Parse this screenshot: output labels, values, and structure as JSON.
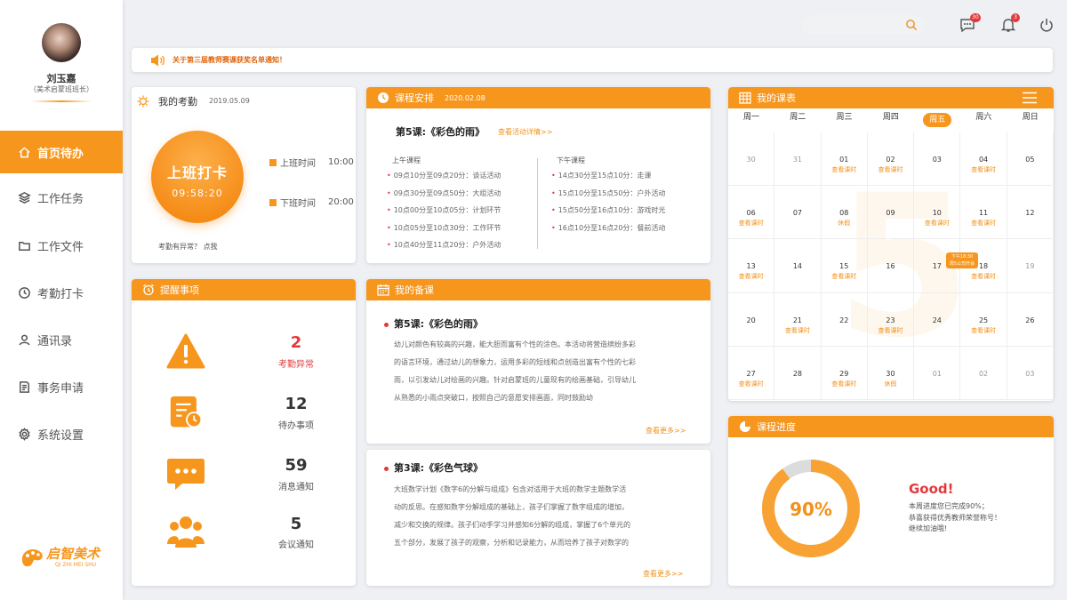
{
  "user": {
    "name": "刘玉嘉",
    "role": "（美术启蒙班班长）"
  },
  "nav": [
    {
      "label": "首页待办",
      "icon": "home-icon",
      "active": true
    },
    {
      "label": "工作任务",
      "icon": "layers-icon"
    },
    {
      "label": "工作文件",
      "icon": "folder-icon"
    },
    {
      "label": "考勤打卡",
      "icon": "clock-icon"
    },
    {
      "label": "通讯录",
      "icon": "person-icon"
    },
    {
      "label": "事务申请",
      "icon": "document-icon"
    },
    {
      "label": "系统设置",
      "icon": "gear-icon"
    }
  ],
  "brand": {
    "name": "启智美术",
    "sub": "QI ZHI MEI SHU"
  },
  "header": {
    "messages_badge": "30",
    "bell_badge": "3"
  },
  "notice": {
    "text": "关于第三届教师赛课获奖名单通知！"
  },
  "attendance": {
    "title": "我的考勤",
    "date": "2019.05.09",
    "punch_label": "上班打卡",
    "punch_time": "09:58:20",
    "start_label": "上班时间",
    "start_time": "10:00",
    "end_label": "下班时间",
    "end_time": "20:00",
    "exception": "考勤有异常？ 点我"
  },
  "schedule": {
    "title": "课程安排",
    "date": "2020.02.08",
    "lesson": "第5课:《彩色的雨》",
    "detail_link": "查看活动详情>>",
    "morning_title": "上午课程",
    "morning": [
      "09点10分至09点20分：谈话活动",
      "09点30分至09点50分：大组活动",
      "10点00分至10点05分：计划环节",
      "10点05分至10点30分：工作环节",
      "10点40分至11点20分：户外活动"
    ],
    "afternoon_title": "下午课程",
    "afternoon": [
      "14点30分至15点10分：走课",
      "15点10分至15点50分：户外活动",
      "15点50分至16点10分：游戏时光",
      "16点10分至16点20分：餐前活动"
    ]
  },
  "reminders": {
    "title": "提醒事项",
    "items": [
      {
        "num": "2",
        "label": "考勤异常",
        "icon": "warning-icon",
        "highlight": true
      },
      {
        "num": "12",
        "label": "待办事项",
        "icon": "task-list-icon"
      },
      {
        "num": "59",
        "label": "消息通知",
        "icon": "chat-bubble-icon"
      },
      {
        "num": "5",
        "label": "会议通知",
        "icon": "group-icon"
      }
    ]
  },
  "lesson_prep": {
    "title": "我的备课",
    "items": [
      {
        "title": "第5课:《彩色的雨》",
        "lines": [
          "幼儿对颜色有较高的兴趣，能大胆而富有个性的涂色。本活动将营造缤纷多彩",
          "的语言环境，通过幼儿的想象力，运用多彩的短线和点创造出富有个性的七彩",
          "雨，以引发幼儿对绘画的兴趣。针对启蒙班的儿童现有的绘画基础，引导幼儿",
          "从熟悉的小雨点突破口，按照自己的意愿安排画面，同时鼓励幼"
        ],
        "more": "查看更多>>"
      },
      {
        "title": "第3课:《彩色气球》",
        "lines": [
          "大班数学计划《数字6的分解与组成》包含对适用于大班的数学主题数学活",
          "动的反思。在感知数字分解组成的基础上，孩子们掌握了数字组成的增加，",
          "减少和交换的规律。孩子们动手学习并感知6分解的组成，掌握了6个单元的",
          "五个部分，发展了孩子的观察，分析和记录能力，从而培养了孩子对数学的"
        ],
        "more": "查看更多>>"
      }
    ]
  },
  "calendar": {
    "title": "我的课表",
    "weekdays": [
      "周一",
      "周二",
      "周三",
      "周四",
      "周五",
      "周六",
      "周日"
    ],
    "active_weekday": 4,
    "big_number": "5",
    "tooltip": [
      "下午18:30",
      "周5公司开会"
    ],
    "cells": [
      {
        "d": "30",
        "gray": true
      },
      {
        "d": "31",
        "gray": true
      },
      {
        "d": "01",
        "n": "查看课时"
      },
      {
        "d": "02",
        "n": "查看课时"
      },
      {
        "d": "03"
      },
      {
        "d": "04",
        "n": "查看课时"
      },
      {
        "d": "05"
      },
      {
        "d": "06",
        "n": "查看课时"
      },
      {
        "d": "07"
      },
      {
        "d": "08",
        "n": "休假"
      },
      {
        "d": "09"
      },
      {
        "d": "10",
        "n": "查看课时"
      },
      {
        "d": "11",
        "n": "查看课时"
      },
      {
        "d": "12"
      },
      {
        "d": "13",
        "n": "查看课时"
      },
      {
        "d": "14"
      },
      {
        "d": "15",
        "n": "查看课时"
      },
      {
        "d": "16"
      },
      {
        "d": "17"
      },
      {
        "d": "18",
        "n": "查看课时"
      },
      {
        "d": "19",
        "gray": true
      },
      {
        "d": "20"
      },
      {
        "d": "21",
        "n": "查看课时"
      },
      {
        "d": "22"
      },
      {
        "d": "23",
        "n": "查看课时"
      },
      {
        "d": "24"
      },
      {
        "d": "25",
        "n": "查看课时"
      },
      {
        "d": "26"
      },
      {
        "d": "27",
        "n": "查看课时"
      },
      {
        "d": "28"
      },
      {
        "d": "29",
        "n": "查看课时"
      },
      {
        "d": "30",
        "n": "休假"
      },
      {
        "d": "01",
        "gray": true
      },
      {
        "d": "02",
        "gray": true
      },
      {
        "d": "03",
        "gray": true
      }
    ]
  },
  "progress": {
    "title": "课程进度",
    "percent": 90,
    "percent_label": "90%",
    "good": "Good!",
    "lines": [
      "本周进度您已完成90%；",
      "恭喜获得优秀教师荣誉称号！",
      "继续加油哦!"
    ]
  },
  "colors": {
    "accent": "#f7961d",
    "red": "#e4393c"
  }
}
